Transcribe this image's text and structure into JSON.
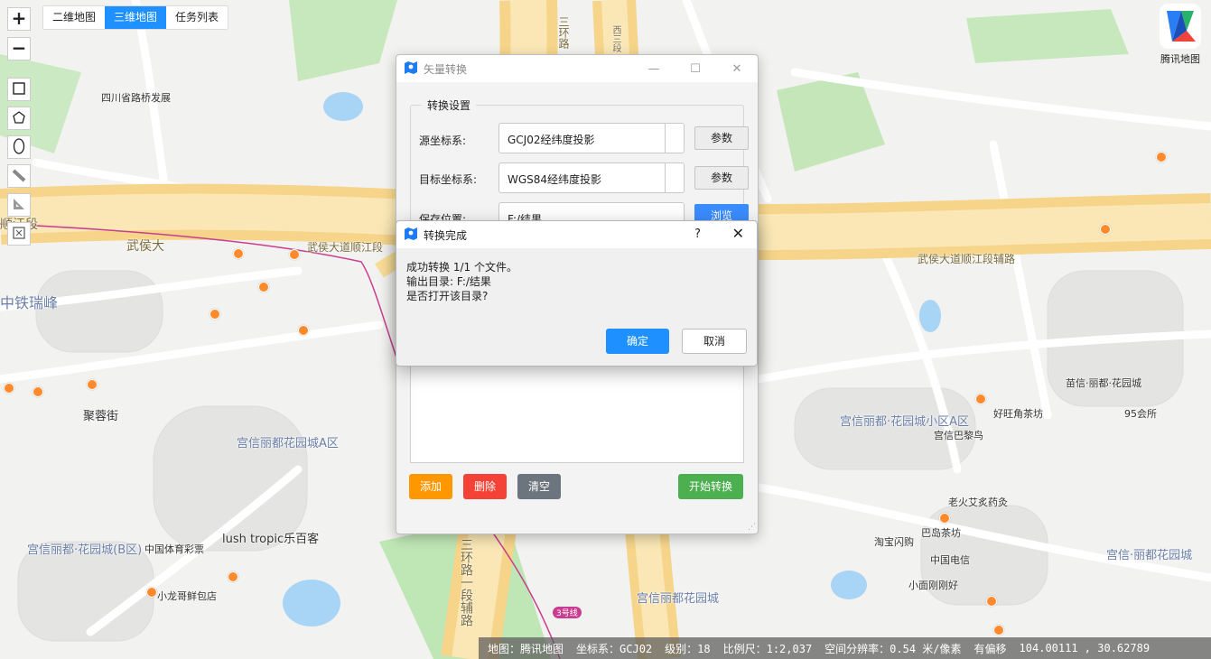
{
  "map": {
    "tabs": [
      "二维地图",
      "三维地图",
      "任务列表"
    ],
    "active_tab": "三维地图",
    "zoom_in": "+",
    "zoom_out": "−",
    "logo_text": "腾讯地图",
    "labels": {
      "road_main_left": "武侯大",
      "road_main_center": "武侯大道顺江段",
      "road_main_right": "武侯大道顺江段辅路",
      "road_left_edge": "顺江段",
      "ring3_top": "三环路",
      "west3": "西三段",
      "ring3_bottom": "三环路一段辅路",
      "cluster_a": "宫信丽都·花园城小区A区",
      "cluster_left": "宫信丽都花园城A区",
      "cluster_b": "宫信丽都·花园城(B区)",
      "cluster_mid": "宫信丽都花园城",
      "cluster_right": "宫信·丽都花园城",
      "pole": "中铁瑞峰",
      "fazhan": "四川省路桥发展",
      "juzhen": "聚蓉街",
      "lush": "lush tropic乐百客",
      "zhongguo_tiyu": "中国体育彩票",
      "xiaolong": "小龙哥鲜包店",
      "huoguo": "老火艾炙药灸",
      "badao": "巴岛茶坊",
      "dianxin": "中国电信",
      "taobao": "淘宝闪购",
      "haowang": "好旺角茶坊",
      "hui95": "95会所",
      "xiaoge": "小面刚刚好",
      "bao": "苗信·丽都·花园城",
      "metro3": "3号线",
      "tiantianpu": "宫信巴黎鸟"
    }
  },
  "status": {
    "source": "地图：腾讯地图",
    "crs": "坐标系：GCJ02",
    "level": "级别：18",
    "scale": "比例尺：1:2,037",
    "resolution": "空间分辨率：0.54 米/像素",
    "offset": "有偏移",
    "coords": "104.00111 , 30.62789"
  },
  "vector_dialog": {
    "title": "矢量转换",
    "group_title": "转换设置",
    "src_label": "源坐标系:",
    "src_value": "GCJ02经纬度投影",
    "dst_label": "目标坐标系:",
    "dst_value": "WGS84经纬度投影",
    "save_label": "保存位置:",
    "save_value": "F:/结果",
    "param_label": "参数",
    "browse_label": "浏览",
    "add": "添加",
    "delete": "删除",
    "clear": "清空",
    "start": "开始转换",
    "colors": {
      "add": "#ff9800",
      "delete": "#f44336",
      "clear": "#6c757d",
      "start": "#4caf50"
    }
  },
  "message_box": {
    "title": "转换完成",
    "help": "?",
    "line1": "成功转换 1/1 个文件。",
    "line2": "输出目录: F:/结果",
    "line3": "是否打开该目录?",
    "ok": "确定",
    "cancel": "取消"
  }
}
